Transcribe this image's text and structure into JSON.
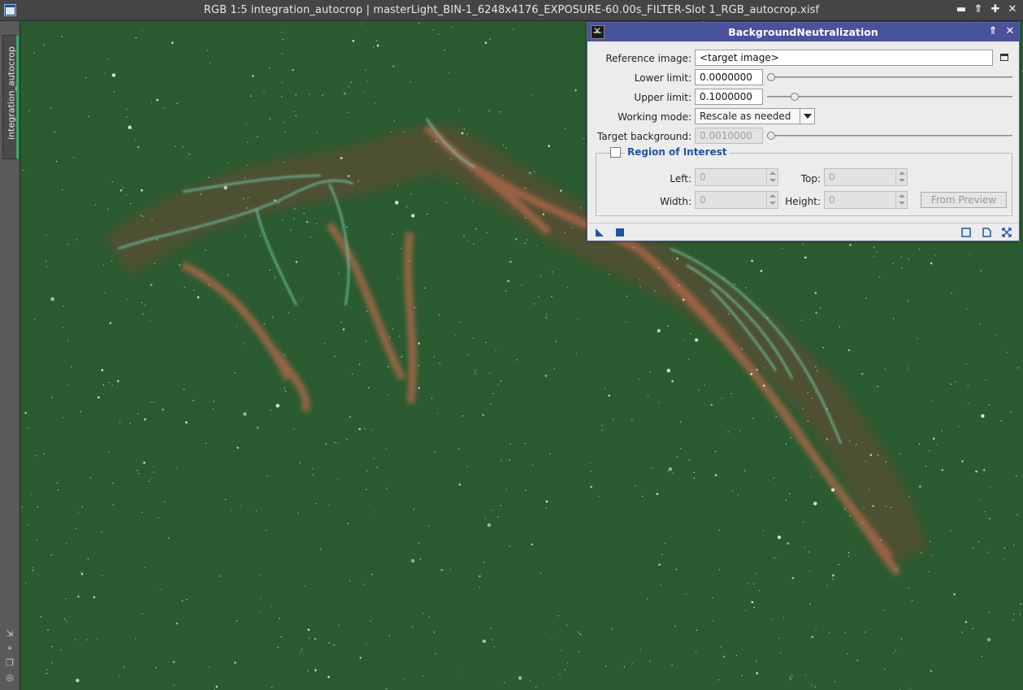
{
  "window": {
    "title": "RGB 1:5 integration_autocrop | masterLight_BIN-1_6248x4176_EXPOSURE-60.00s_FILTER-Slot 1_RGB_autocrop.xisf",
    "controls": [
      "minimize-icon",
      "shade-icon",
      "maximize-icon",
      "close-icon"
    ]
  },
  "left_tab": {
    "label": "integration_autocrop"
  },
  "left_tools": [
    "fit-icon",
    "zoom-icon",
    "copy-icon",
    "settings-icon"
  ],
  "dialog": {
    "title": "BackgroundNeutralization",
    "fields": {
      "reference_image": {
        "label": "Reference image:",
        "value": "<target image>"
      },
      "lower_limit": {
        "label": "Lower limit:",
        "value": "0.0000000",
        "slider": 0.0
      },
      "upper_limit": {
        "label": "Upper limit:",
        "value": "0.1000000",
        "slider": 0.1
      },
      "working_mode": {
        "label": "Working mode:",
        "value": "Rescale as needed"
      },
      "target_background": {
        "label": "Target background:",
        "value": "0.0010000",
        "slider": 0.001
      }
    },
    "roi": {
      "title": "Region of Interest",
      "checked": false,
      "left": {
        "label": "Left:",
        "value": "0"
      },
      "top": {
        "label": "Top:",
        "value": "0"
      },
      "width": {
        "label": "Width:",
        "value": "0"
      },
      "height": {
        "label": "Height:",
        "value": "0"
      },
      "from_preview": "From Preview"
    }
  },
  "colors": {
    "background_green": "#2a5a2f",
    "dialog_title_bar": "#4a529c",
    "roi_title": "#1d55a6"
  }
}
